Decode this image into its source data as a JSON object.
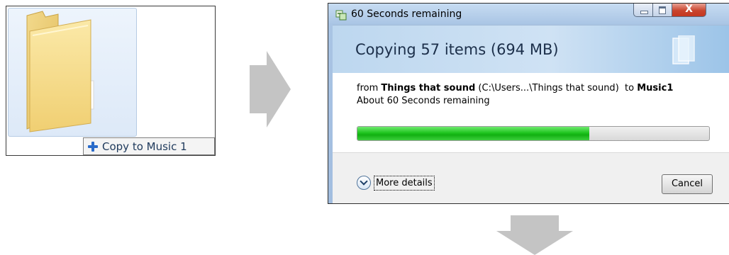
{
  "drag_preview": {
    "copy_hint": "Copy to Music 1"
  },
  "dialog": {
    "title": "60 Seconds remaining",
    "close_glyph": "X",
    "header": "Copying 57 items (694 MB)",
    "from_prefix": "from",
    "source_name": "Things that sound",
    "source_path": "(C:\\Users...\\Things that sound)",
    "to_prefix": "to",
    "destination_name": "Music1",
    "time_remaining": "About 60 Seconds remaining",
    "progress_fraction": 0.66,
    "more_details_label": "More details",
    "cancel_label": "Cancel"
  },
  "icons": {
    "folder": "folder-icon",
    "plus": "plus-icon",
    "copy_app": "copy-dialog-icon",
    "chevron": "chevron-down-icon",
    "arrow_right": "arrow-right-icon",
    "arrow_down": "arrow-down-icon"
  },
  "colors": {
    "progress_green": "#1fc51f",
    "close_red": "#c9452e",
    "arrow_gray": "#c4c4c4"
  }
}
